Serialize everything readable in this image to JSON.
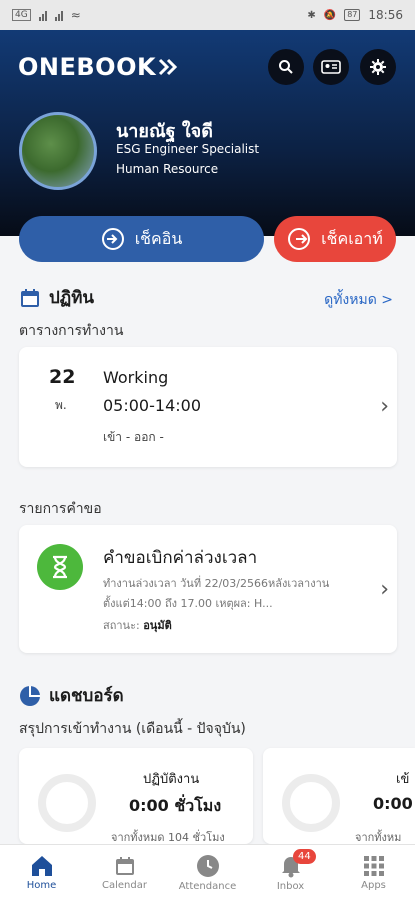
{
  "status_bar": {
    "time": "18:56",
    "battery": "87"
  },
  "header": {
    "logo": "ONEBOOK"
  },
  "profile": {
    "name": "นายณัฐ ใจดี",
    "role": "ESG Engineer Specialist",
    "department": "Human Resource"
  },
  "actions": {
    "check_in": "เช็คอิน",
    "check_out": "เช็คเอาท์"
  },
  "calendar_section": {
    "title": "ปฏิทิน",
    "see_all": "ดูทั้งหมด >",
    "schedule_label": "ตารางการทำงาน",
    "schedule": {
      "day": "22",
      "weekday": "พ.",
      "title": "Working",
      "time": "05:00-14:00",
      "in_out": "เข้า - ออก -"
    },
    "requests_label": "รายการคำขอ",
    "request": {
      "title": "คำขอเบิกค่าล่วงเวลา",
      "description": "ทำงานล่วงเวลา วันที่ 22/03/2566หลังเวลางานตั้งแต่14:00 ถึง 17.00 เหตุผล: H...",
      "status_label": "สถานะ:",
      "status_value": "อนุมัติ"
    }
  },
  "dashboard_section": {
    "title": "แดชบอร์ด",
    "summary_label": "สรุปการเข้าทำงาน (เดือนนี้ - ปัจจุบัน)",
    "cards": [
      {
        "label": "ปฏิบัติงาน",
        "value": "0:00 ชั่วโมง",
        "sub": "จากทั้งหมด 104 ชั่วโมง"
      },
      {
        "label": "เข้",
        "value": "0:00",
        "sub": "จากทั้งหม"
      }
    ]
  },
  "nav": {
    "items": [
      {
        "label": "Home",
        "icon": "home-icon"
      },
      {
        "label": "Calendar",
        "icon": "calendar-icon"
      },
      {
        "label": "Attendance",
        "icon": "clock-icon"
      },
      {
        "label": "Inbox",
        "icon": "bell-icon",
        "badge": "44"
      },
      {
        "label": "Apps",
        "icon": "grid-icon"
      }
    ]
  },
  "colors": {
    "primary": "#2f5fa8",
    "danger": "#e8463c",
    "success": "#4db83c",
    "link": "#2b68c5"
  }
}
